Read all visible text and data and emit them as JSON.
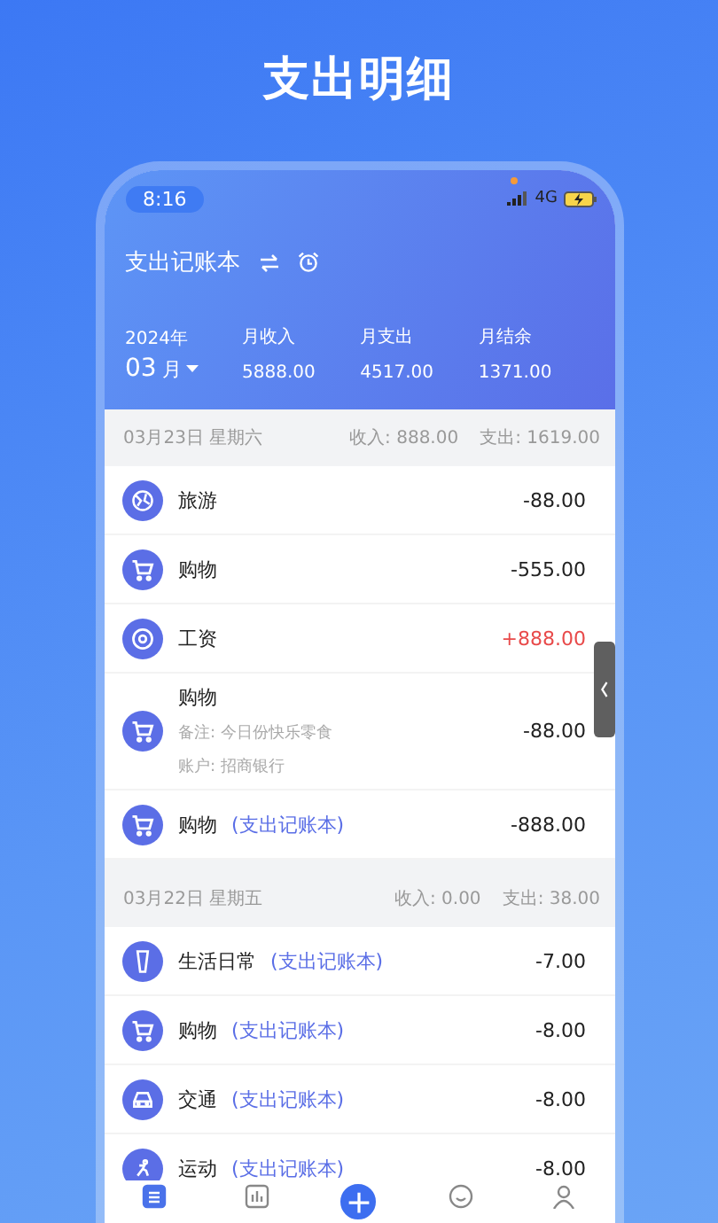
{
  "page_title": "支出明细",
  "status_bar": {
    "time": "8:16",
    "network": "4G"
  },
  "header": {
    "book_title": "支出记账本",
    "year": "2024年",
    "month": "03",
    "month_unit": "月",
    "stats": [
      {
        "label": "月收入",
        "value": "5888.00"
      },
      {
        "label": "月支出",
        "value": "4517.00"
      },
      {
        "label": "月结余",
        "value": "1371.00"
      }
    ]
  },
  "days": [
    {
      "date": "03月23日 星期六",
      "income": "收入: 888.00",
      "expense": "支出: 1619.00",
      "entries": [
        {
          "kind": "travel",
          "category": "旅游",
          "amount": "-88.00",
          "income": false
        },
        {
          "kind": "shopping",
          "category": "购物",
          "amount": "-555.00",
          "income": false
        },
        {
          "kind": "salary",
          "category": "工资",
          "amount": "+888.00",
          "income": true
        },
        {
          "kind": "shopping",
          "category": "购物",
          "note": "备注: 今日份快乐零食",
          "account": "账户: 招商银行",
          "amount": "-88.00",
          "income": false
        },
        {
          "kind": "shopping",
          "category": "购物",
          "book": "(支出记账本)",
          "amount": "-888.00",
          "income": false
        }
      ]
    },
    {
      "date": "03月22日 星期五",
      "income": "收入: 0.00",
      "expense": "支出: 38.00",
      "entries": [
        {
          "kind": "daily",
          "category": "生活日常",
          "book": "(支出记账本)",
          "amount": "-7.00",
          "income": false
        },
        {
          "kind": "shopping",
          "category": "购物",
          "book": "(支出记账本)",
          "amount": "-8.00",
          "income": false
        },
        {
          "kind": "transport",
          "category": "交通",
          "book": "(支出记账本)",
          "amount": "-8.00",
          "income": false
        },
        {
          "kind": "sport",
          "category": "运动",
          "book": "(支出记账本)",
          "amount": "-8.00",
          "income": false
        }
      ]
    }
  ],
  "nav": [
    {
      "kind": "list",
      "selected": true
    },
    {
      "kind": "chart",
      "selected": false
    },
    {
      "kind": "add"
    },
    {
      "kind": "face",
      "selected": false
    },
    {
      "kind": "person",
      "selected": false
    }
  ]
}
